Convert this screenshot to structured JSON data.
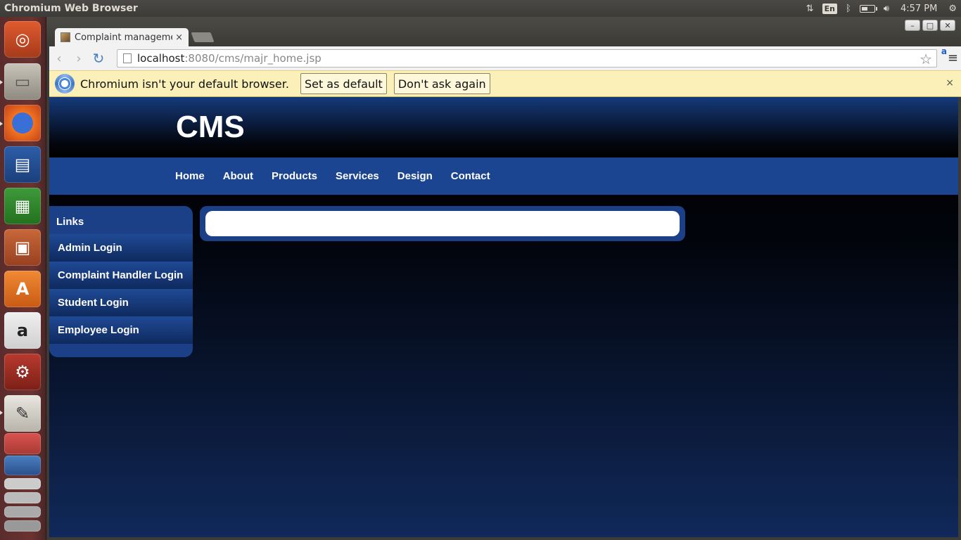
{
  "top_panel": {
    "window_title": "Chromium Web Browser",
    "lang": "En",
    "clock": "4:57 PM"
  },
  "browser": {
    "tab": {
      "title": "Complaint manageme",
      "close": "×"
    },
    "address": {
      "host": "localhost",
      "path": ":8080/cms/majr_home.jsp"
    },
    "infobar": {
      "message": "Chromium isn't your default browser.",
      "set_default": "Set as default",
      "dont_ask": "Don't ask again",
      "close": "×"
    }
  },
  "page": {
    "logo": "CMS",
    "nav": [
      "Home",
      "About",
      "Products",
      "Services",
      "Design",
      "Contact"
    ],
    "sidebar": {
      "title": "Links",
      "items": [
        "Admin Login",
        "Complaint Handler Login",
        "Student Login",
        "Employee Login"
      ]
    }
  },
  "launcher": [
    "ubuntu-dash",
    "files",
    "firefox",
    "writer",
    "calc",
    "impress",
    "software-center",
    "amazon",
    "system-settings",
    "text-editor",
    "app-1",
    "app-2",
    "app-3"
  ]
}
